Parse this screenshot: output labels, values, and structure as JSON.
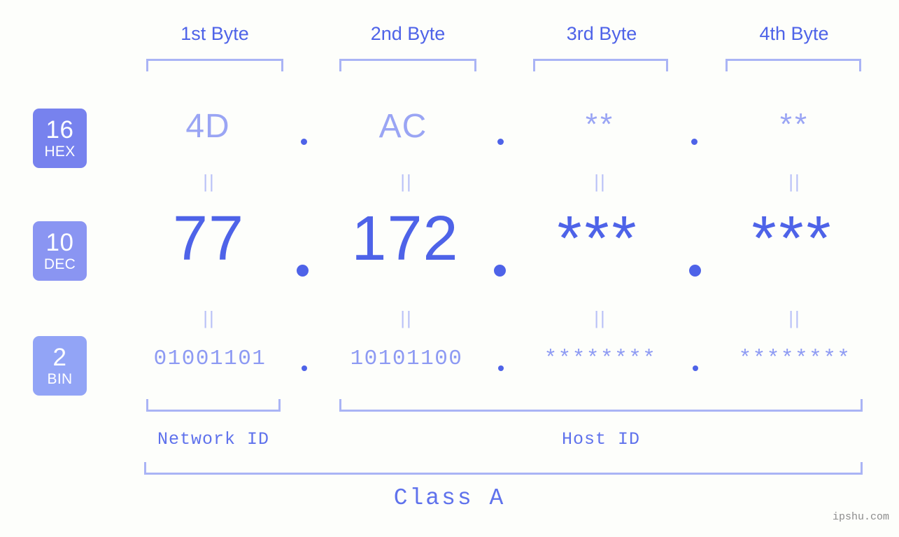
{
  "meta": {
    "background": "#fdfefb",
    "accent": "#4e63e8",
    "accent_light": "#aab4f5",
    "watermark": "ipshu.com"
  },
  "byte_headers": [
    {
      "label": "1st Byte"
    },
    {
      "label": "2nd Byte"
    },
    {
      "label": "3rd Byte"
    },
    {
      "label": "4th Byte"
    }
  ],
  "bases": [
    {
      "num": "16",
      "name": "HEX",
      "color": "#7782ee"
    },
    {
      "num": "10",
      "name": "DEC",
      "color": "#8a95f2"
    },
    {
      "num": "2",
      "name": "BIN",
      "color": "#92a4f6"
    }
  ],
  "rows": {
    "hex": {
      "values": [
        "4D",
        "AC",
        "**",
        "**"
      ]
    },
    "dec": {
      "values": [
        "77",
        "172",
        "***",
        "***"
      ]
    },
    "bin": {
      "values": [
        "01001101",
        "10101100",
        "********",
        "********"
      ]
    }
  },
  "separators": {
    "dot": ".",
    "equals": "||"
  },
  "id_sections": [
    {
      "label": "Network ID"
    },
    {
      "label": "Host ID"
    }
  ],
  "class": {
    "label": "Class A"
  }
}
